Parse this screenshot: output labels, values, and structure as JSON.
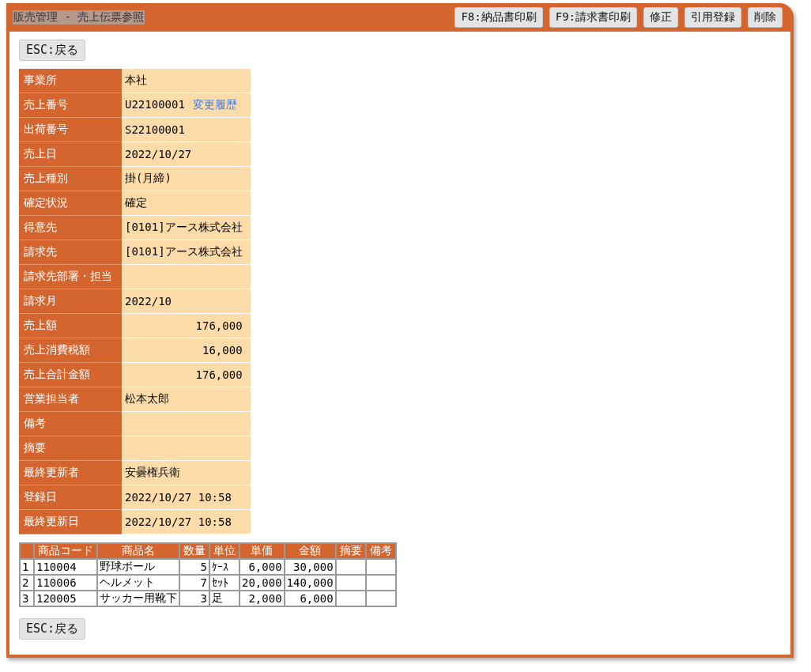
{
  "window": {
    "title": "販売管理 - 売上伝票参照"
  },
  "toolbar": [
    "F8:納品書印刷",
    "F9:請求書印刷",
    "修正",
    "引用登録",
    "削除"
  ],
  "back_button_top": "ESC:戻る",
  "fields": [
    {
      "label": "事業所",
      "value": "本社",
      "kind": "text"
    },
    {
      "label": "売上番号",
      "value": "U22100001",
      "kind": "link",
      "link": "変更履歴"
    },
    {
      "label": "出荷番号",
      "value": "S22100001",
      "kind": "text"
    },
    {
      "label": "売上日",
      "value": "2022/10/27",
      "kind": "text"
    },
    {
      "label": "売上種別",
      "value": "掛(月締)",
      "kind": "text"
    },
    {
      "label": "確定状況",
      "value": "確定",
      "kind": "text"
    },
    {
      "label": "得意先",
      "value": "[0101]アース株式会社",
      "kind": "text"
    },
    {
      "label": "請求先",
      "value": "[0101]アース株式会社",
      "kind": "text"
    },
    {
      "label": "請求先部署・担当",
      "kind": "text"
    },
    {
      "label": "請求月",
      "value": "2022/10",
      "kind": "text"
    },
    {
      "label": "売上額",
      "value": "176,000",
      "kind": "number"
    },
    {
      "label": "売上消費税額",
      "value": "16,000",
      "kind": "number"
    },
    {
      "label": "売上合計金額",
      "value": "176,000",
      "kind": "number"
    },
    {
      "label": "営業担当者",
      "value": "松本太郎",
      "kind": "text"
    },
    {
      "label": "備考",
      "kind": "text"
    },
    {
      "label": "摘要",
      "kind": "text"
    },
    {
      "label": "最終更新者",
      "value": "安曇権兵衛",
      "kind": "text"
    },
    {
      "label": "登録日",
      "value": "2022/10/27 10:58",
      "kind": "text"
    },
    {
      "label": "最終更新日",
      "value": "2022/10/27 10:58",
      "kind": "text"
    }
  ],
  "table": {
    "columns": [
      "",
      "商品コード",
      "商品名",
      "数量",
      "単位",
      "単価",
      "金額",
      "摘要",
      "備考"
    ],
    "rows": [
      [
        "1",
        "110004",
        "野球ボール",
        "5",
        "ｹｰｽ",
        "6,000",
        "30,000",
        "",
        ""
      ],
      [
        "2",
        "110006",
        "ヘルメット",
        "7",
        "ｾｯﾄ",
        "20,000",
        "140,000",
        "",
        ""
      ],
      [
        "3",
        "120005",
        "サッカー用靴下",
        "3",
        "足",
        "2,000",
        "6,000",
        "",
        ""
      ]
    ]
  },
  "back_button_bottom": "ESC:戻る"
}
